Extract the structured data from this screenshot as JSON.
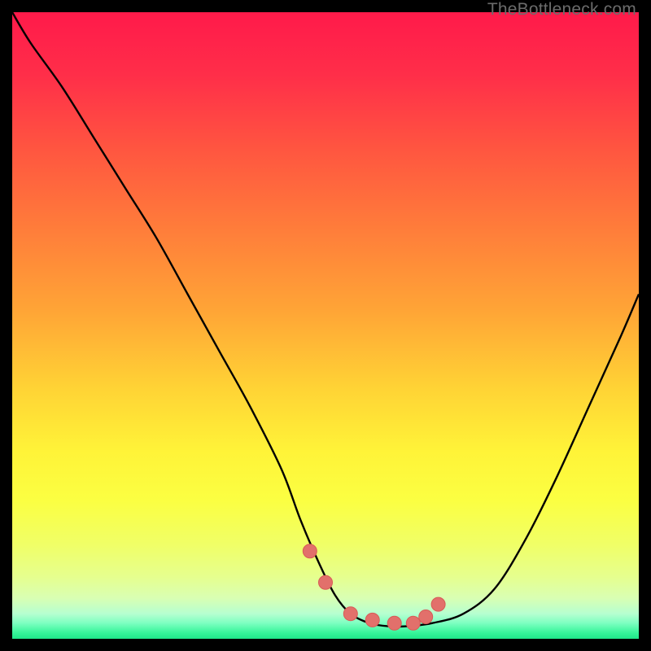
{
  "watermark": "TheBottleneck.com",
  "colors": {
    "frame": "#000000",
    "curve": "#000000",
    "marker_fill": "#e2706b",
    "marker_stroke": "#d85a56",
    "gradient_stops": [
      {
        "offset": 0.0,
        "color": "#ff1a4a"
      },
      {
        "offset": 0.1,
        "color": "#ff2e49"
      },
      {
        "offset": 0.22,
        "color": "#ff5640"
      },
      {
        "offset": 0.35,
        "color": "#ff7e3a"
      },
      {
        "offset": 0.48,
        "color": "#ffa636"
      },
      {
        "offset": 0.6,
        "color": "#ffd335"
      },
      {
        "offset": 0.7,
        "color": "#fff338"
      },
      {
        "offset": 0.78,
        "color": "#fbff42"
      },
      {
        "offset": 0.85,
        "color": "#f0ff67"
      },
      {
        "offset": 0.9,
        "color": "#e6ff8d"
      },
      {
        "offset": 0.935,
        "color": "#d9ffb3"
      },
      {
        "offset": 0.96,
        "color": "#b6ffd0"
      },
      {
        "offset": 0.975,
        "color": "#7dffc1"
      },
      {
        "offset": 0.99,
        "color": "#38f59a"
      },
      {
        "offset": 1.0,
        "color": "#1fe689"
      }
    ]
  },
  "chart_data": {
    "type": "line",
    "title": "",
    "xlabel": "",
    "ylabel": "",
    "xlim": [
      0,
      100
    ],
    "ylim": [
      0,
      100
    ],
    "grid": false,
    "legend": false,
    "series": [
      {
        "name": "curve",
        "x": [
          0,
          3,
          8,
          13,
          18,
          23,
          28,
          33,
          38,
          43,
          46,
          49,
          51.5,
          54,
          57,
          60,
          63,
          67,
          72,
          77,
          82,
          87,
          92,
          97,
          100
        ],
        "y": [
          100,
          95,
          88,
          80,
          72,
          64,
          55,
          46,
          37,
          27,
          19,
          12,
          7,
          4,
          2.5,
          2,
          2,
          2.5,
          4,
          8,
          16,
          26,
          37,
          48,
          55
        ]
      }
    ],
    "markers": {
      "name": "highlight-points",
      "x": [
        47.5,
        50,
        54,
        57.5,
        61,
        64,
        66,
        68
      ],
      "y": [
        14,
        9,
        4,
        3,
        2.5,
        2.5,
        3.5,
        5.5
      ]
    }
  }
}
